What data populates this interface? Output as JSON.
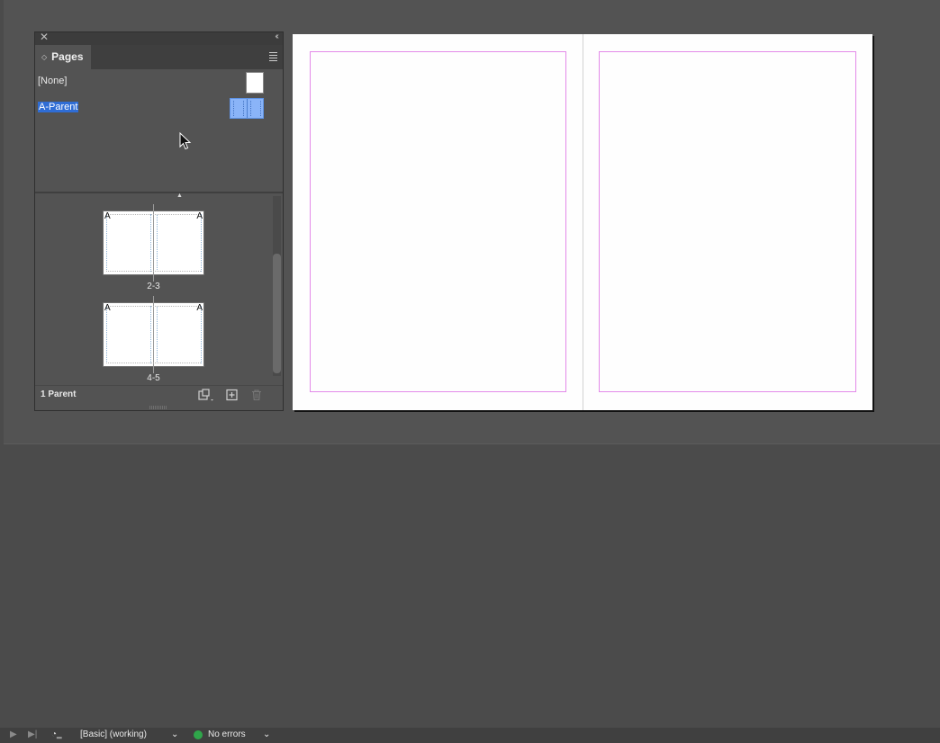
{
  "panel": {
    "title": "Pages",
    "parents": [
      {
        "label": "[None]",
        "selected": false
      },
      {
        "label": "A-Parent",
        "selected": true
      }
    ],
    "spreads": [
      {
        "label": "2-3",
        "left_letter": "A",
        "right_letter": "A"
      },
      {
        "label": "4-5",
        "left_letter": "A",
        "right_letter": "A"
      }
    ],
    "footer_label": "1 Parent"
  },
  "status_bar": {
    "preflight_profile": "[Basic] (working)",
    "status_text": "No errors",
    "status_color": "#2fa64a"
  },
  "colors": {
    "margin_guide": "#e38ae9",
    "selection": "#2f6dd5",
    "parent_thumb": "#8ab4f8"
  }
}
